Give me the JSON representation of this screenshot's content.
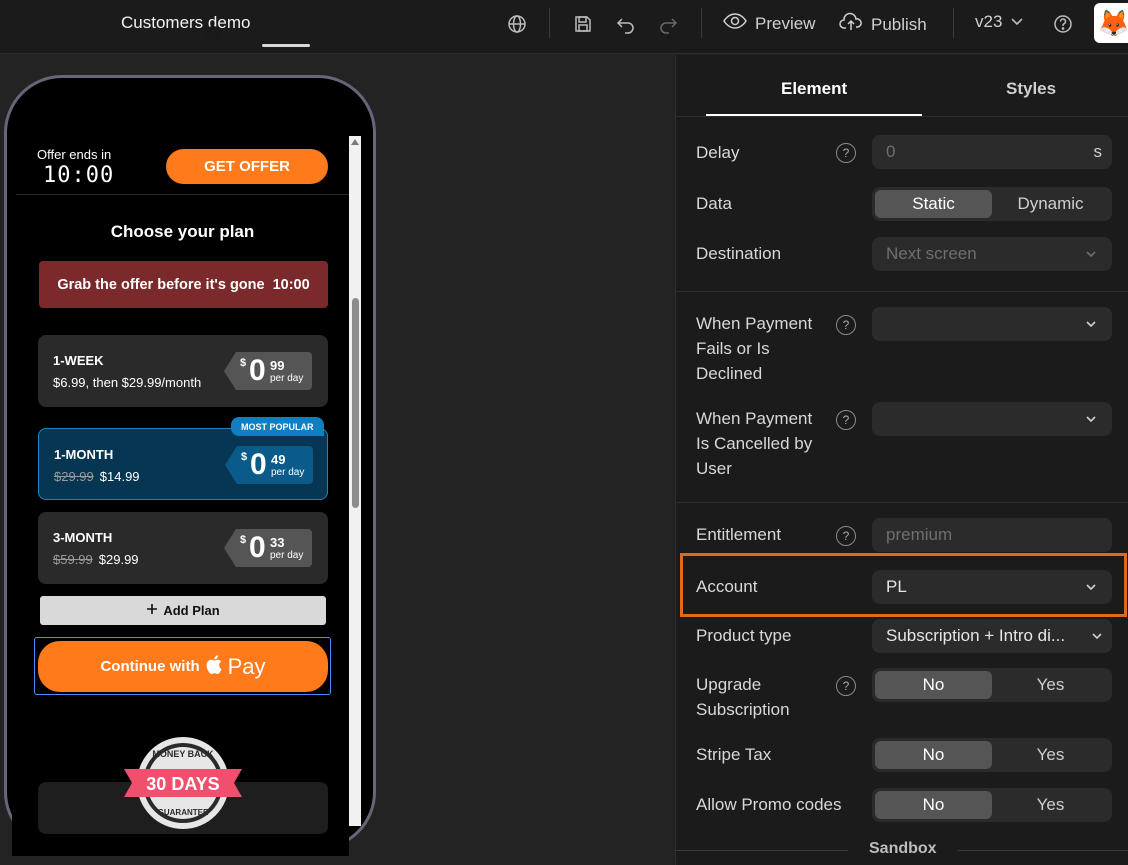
{
  "topbar": {
    "title": "Customers demo",
    "preview_label": "Preview",
    "publish_label": "Publish",
    "version": "v23",
    "avatar_icon": "fox-icon"
  },
  "preview": {
    "offer_label": "Offer ends in",
    "offer_timer": "10:00",
    "get_offer_label": "GET OFFER",
    "plan_title": "Choose your plan",
    "urgency_text": "Grab the offer before it's gone",
    "urgency_timer": "10:00",
    "plans": [
      {
        "name": "1-WEEK",
        "subtitle": "$6.99, then $29.99/month",
        "old_price": "",
        "new_price": "",
        "dollar": "$",
        "int": "0",
        "cents": "99",
        "per": "per day"
      },
      {
        "name": "1-MONTH",
        "subtitle": "",
        "old_price": "$29.99",
        "new_price": "$14.99",
        "dollar": "$",
        "int": "0",
        "cents": "49",
        "per": "per day",
        "badge": "MOST POPULAR"
      },
      {
        "name": "3-MONTH",
        "subtitle": "",
        "old_price": "$59.99",
        "new_price": "$29.99",
        "dollar": "$",
        "int": "0",
        "cents": "33",
        "per": "per day"
      }
    ],
    "add_plan_label": "Add Plan",
    "pay_label": "Continue with",
    "pay_word": "Pay",
    "seal_top": "MONEY BACK",
    "seal_days": "30 DAYS",
    "seal_bottom": "GUARANTEE"
  },
  "panel": {
    "tabs": [
      {
        "label": "Element"
      },
      {
        "label": "Styles"
      }
    ],
    "delay": {
      "label": "Delay",
      "placeholder": "0",
      "suffix": "s"
    },
    "data": {
      "label": "Data",
      "options": [
        "Static",
        "Dynamic"
      ],
      "selected": "Static"
    },
    "destination": {
      "label": "Destination",
      "value": "Next screen"
    },
    "payment_fails": {
      "label_lines": [
        "When Payment",
        "Fails or Is",
        "Declined"
      ],
      "value": ""
    },
    "payment_cancelled": {
      "label_lines": [
        "When Payment",
        "Is Cancelled by",
        "User"
      ],
      "value": ""
    },
    "entitlement": {
      "label": "Entitlement",
      "placeholder": "premium"
    },
    "account": {
      "label": "Account",
      "value": "PL"
    },
    "product_type": {
      "label": "Product type",
      "value": "Subscription + Intro di..."
    },
    "upgrade": {
      "label_lines": [
        "Upgrade",
        "Subscription"
      ],
      "options": [
        "No",
        "Yes"
      ],
      "selected": "No"
    },
    "stripe_tax": {
      "label": "Stripe Tax",
      "options": [
        "No",
        "Yes"
      ],
      "selected": "No"
    },
    "promo": {
      "label": "Allow Promo codes",
      "options": [
        "No",
        "Yes"
      ],
      "selected": "No"
    },
    "sandbox_label": "Sandbox"
  }
}
